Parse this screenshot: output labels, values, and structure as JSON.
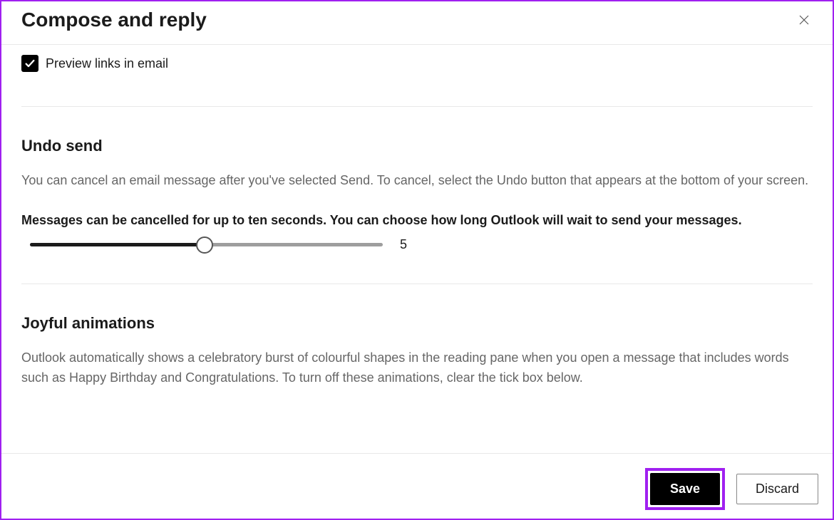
{
  "header": {
    "title": "Compose and reply"
  },
  "linkPreview": {
    "label": "Preview links in email",
    "checked": true
  },
  "undoSend": {
    "title": "Undo send",
    "description": "You can cancel an email message after you've selected Send. To cancel, select the Undo button that appears at the bottom of your screen.",
    "instruction": "Messages can be cancelled for up to ten seconds. You can choose how long Outlook will wait to send your messages.",
    "value": "5"
  },
  "joyful": {
    "title": "Joyful animations",
    "description": "Outlook automatically shows a celebratory burst of colourful shapes in the reading pane when you open a message that includes words such as Happy Birthday and Congratulations. To turn off these animations, clear the tick box below."
  },
  "footer": {
    "save": "Save",
    "discard": "Discard"
  }
}
